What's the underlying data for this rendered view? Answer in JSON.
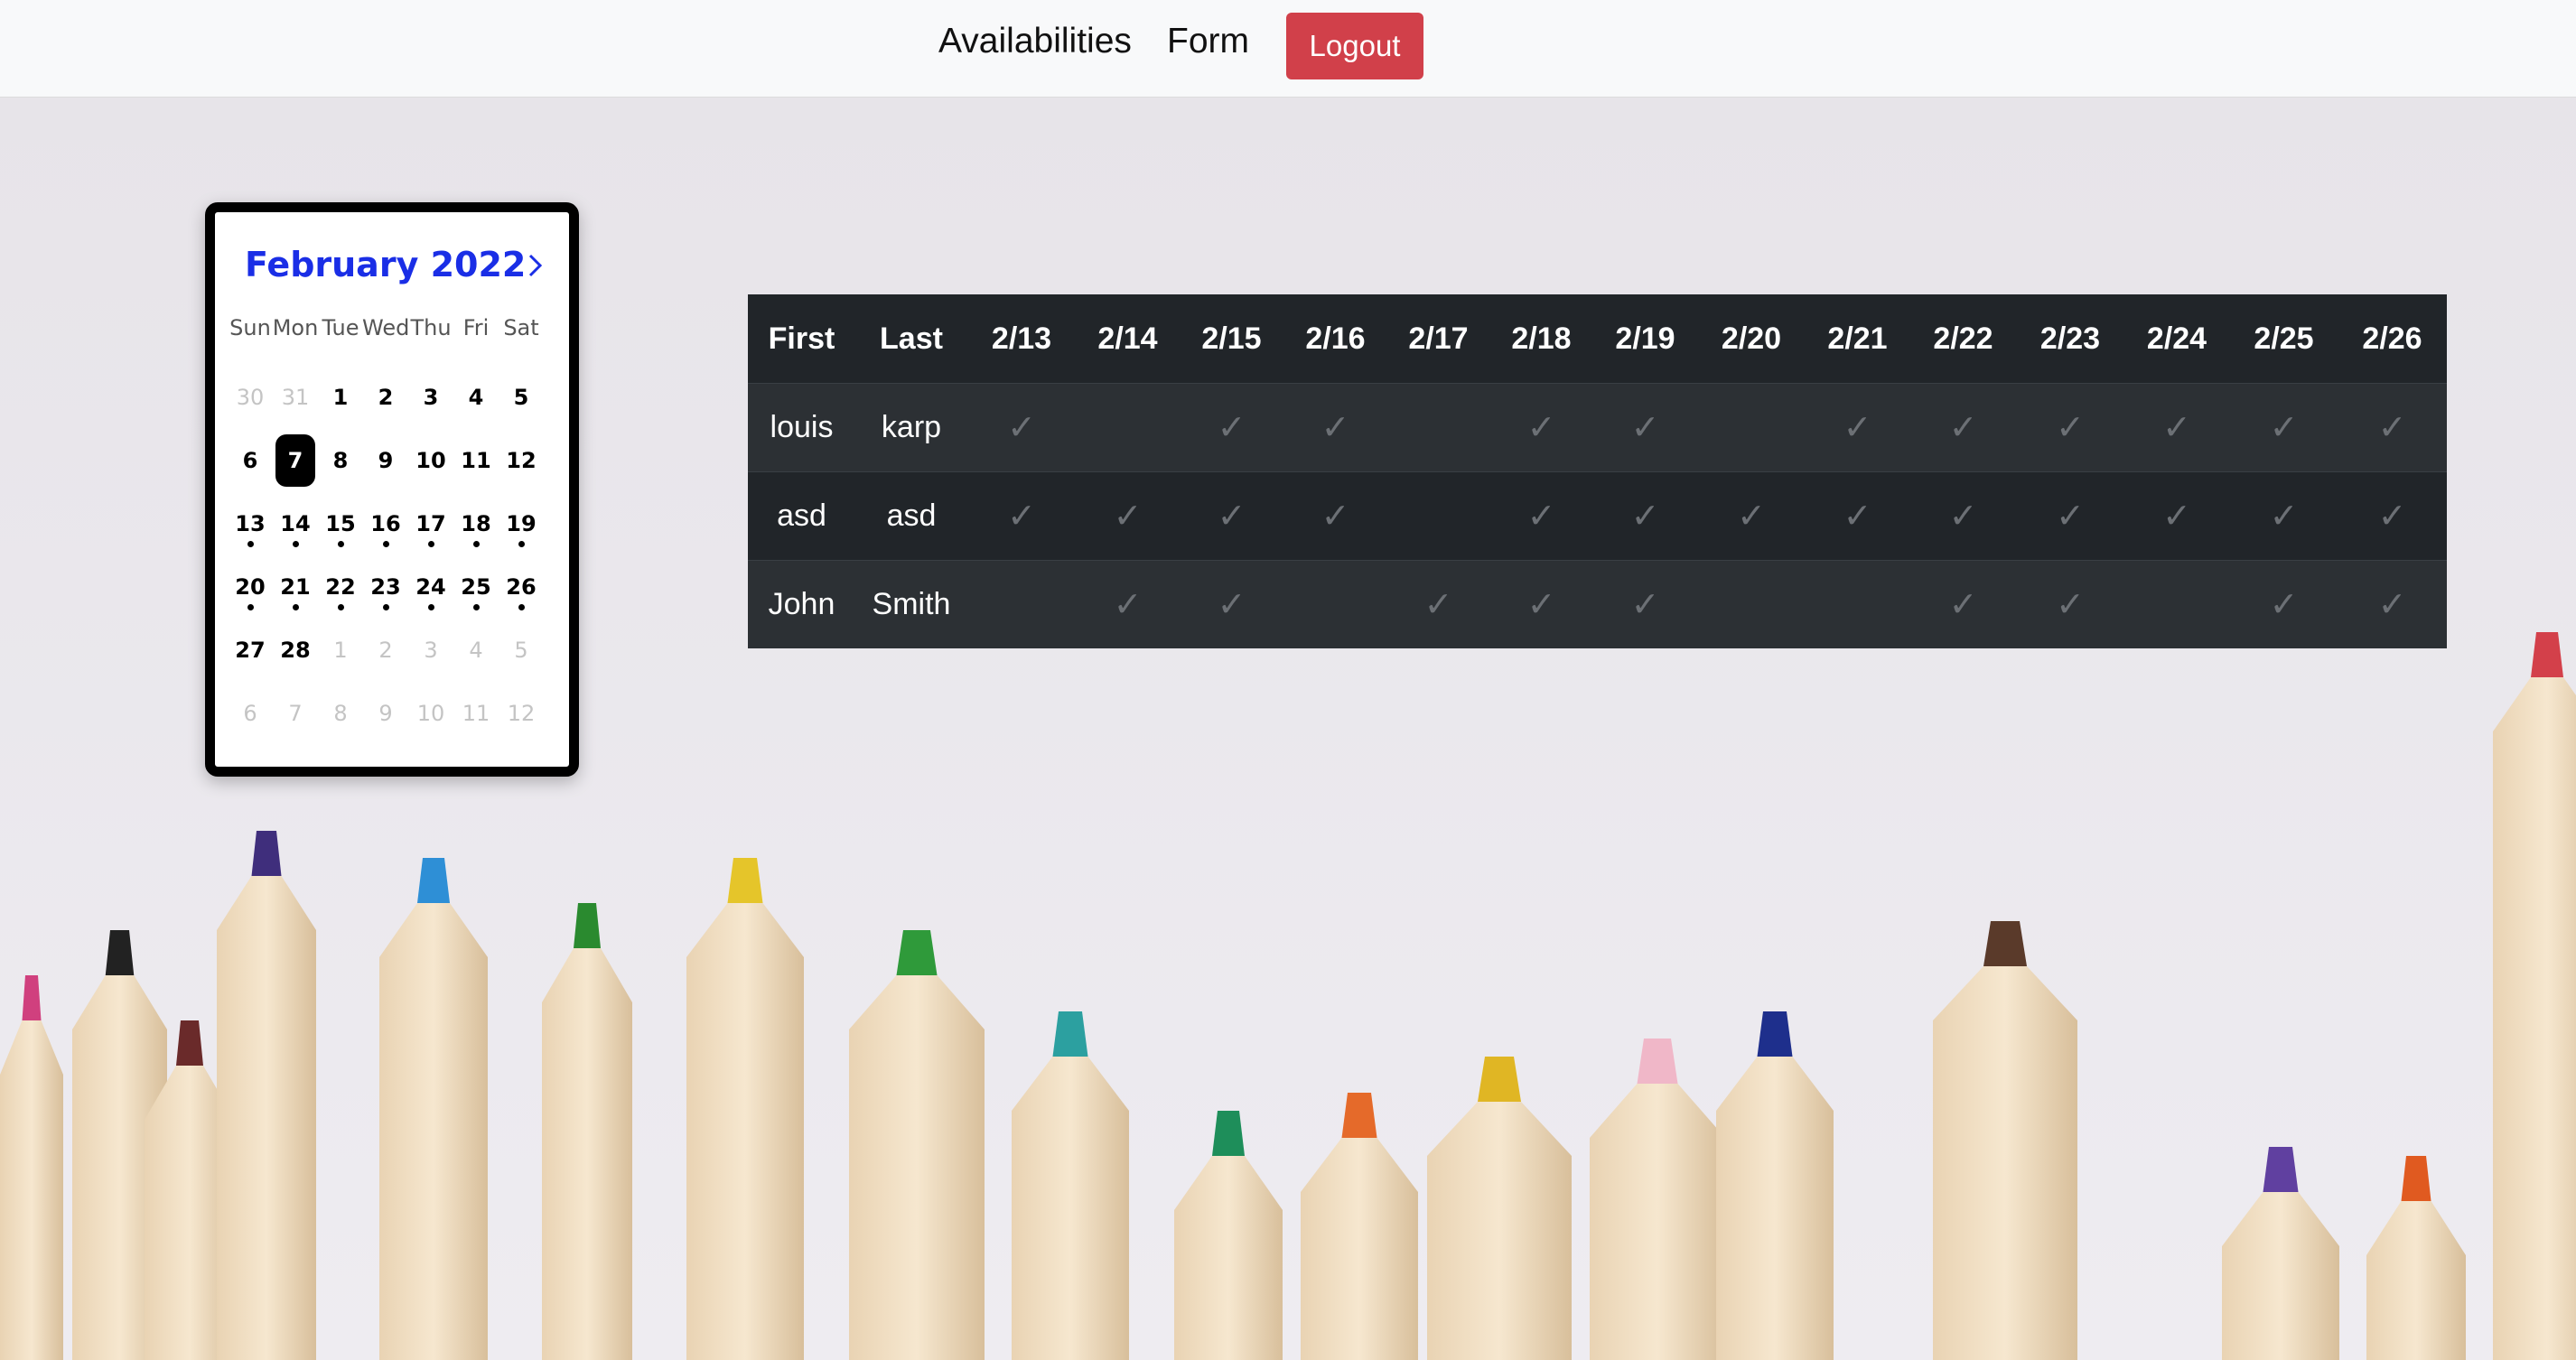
{
  "nav": {
    "availabilities": "Availabilities",
    "form": "Form",
    "logout": "Logout"
  },
  "calendar": {
    "title": "February 2022",
    "next_icon": "chevron-right-icon",
    "weekdays": [
      "Sun",
      "Mon",
      "Tue",
      "Wed",
      "Thu",
      "Fri",
      "Sat"
    ],
    "weeks": [
      [
        {
          "d": "30",
          "m": true
        },
        {
          "d": "31",
          "m": true
        },
        {
          "d": "1"
        },
        {
          "d": "2"
        },
        {
          "d": "3"
        },
        {
          "d": "4"
        },
        {
          "d": "5"
        }
      ],
      [
        {
          "d": "6"
        },
        {
          "d": "7",
          "sel": true
        },
        {
          "d": "8"
        },
        {
          "d": "9"
        },
        {
          "d": "10"
        },
        {
          "d": "11"
        },
        {
          "d": "12"
        }
      ],
      [
        {
          "d": "13",
          "dot": true
        },
        {
          "d": "14",
          "dot": true
        },
        {
          "d": "15",
          "dot": true
        },
        {
          "d": "16",
          "dot": true
        },
        {
          "d": "17",
          "dot": true
        },
        {
          "d": "18",
          "dot": true
        },
        {
          "d": "19",
          "dot": true
        }
      ],
      [
        {
          "d": "20",
          "dot": true
        },
        {
          "d": "21",
          "dot": true
        },
        {
          "d": "22",
          "dot": true
        },
        {
          "d": "23",
          "dot": true
        },
        {
          "d": "24",
          "dot": true
        },
        {
          "d": "25",
          "dot": true
        },
        {
          "d": "26",
          "dot": true
        }
      ],
      [
        {
          "d": "27"
        },
        {
          "d": "28"
        },
        {
          "d": "1",
          "m": true
        },
        {
          "d": "2",
          "m": true
        },
        {
          "d": "3",
          "m": true
        },
        {
          "d": "4",
          "m": true
        },
        {
          "d": "5",
          "m": true
        }
      ],
      [
        {
          "d": "6",
          "m": true
        },
        {
          "d": "7",
          "m": true
        },
        {
          "d": "8",
          "m": true
        },
        {
          "d": "9",
          "m": true
        },
        {
          "d": "10",
          "m": true
        },
        {
          "d": "11",
          "m": true
        },
        {
          "d": "12",
          "m": true
        }
      ]
    ]
  },
  "table": {
    "headers": [
      "First",
      "Last",
      "2/13",
      "2/14",
      "2/15",
      "2/16",
      "2/17",
      "2/18",
      "2/19",
      "2/20",
      "2/21",
      "2/22",
      "2/23",
      "2/24",
      "2/25",
      "2/26"
    ],
    "check_glyph": "✓",
    "rows": [
      {
        "first": "louis",
        "last": "karp",
        "avail": [
          1,
          0,
          1,
          1,
          0,
          1,
          1,
          0,
          1,
          1,
          1,
          1,
          1,
          1
        ]
      },
      {
        "first": "asd",
        "last": "asd",
        "avail": [
          1,
          1,
          1,
          1,
          0,
          1,
          1,
          1,
          1,
          1,
          1,
          1,
          1,
          1
        ]
      },
      {
        "first": "John",
        "last": "Smith",
        "avail": [
          0,
          1,
          1,
          0,
          1,
          1,
          1,
          0,
          0,
          1,
          1,
          0,
          1,
          1
        ]
      }
    ]
  }
}
